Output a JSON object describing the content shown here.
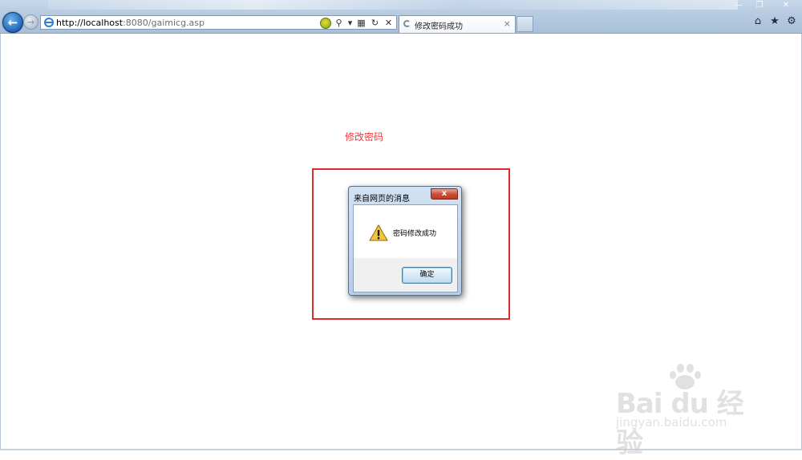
{
  "browser": {
    "address_url_host": "http://localhost",
    "address_url_rest": ":8080/gaimicg.asp",
    "tab_title": "修改密码成功",
    "tab_close": "×",
    "win_minimize": "—",
    "win_restore": "❐",
    "win_close": "✕",
    "icons": [
      "back-arrow-icon",
      "forward-arrow-icon",
      "ie-page-icon",
      "compatibility-icon",
      "search-icon",
      "dropdown-icon",
      "compat-view-icon",
      "refresh-icon",
      "stop-icon",
      "home-icon",
      "favorites-star-icon",
      "tools-gear-icon"
    ]
  },
  "page": {
    "heading": "修改密码"
  },
  "dialog": {
    "title": "来自网页的消息",
    "close_label": "x",
    "message": "密码修改成功",
    "ok_label": "确定",
    "icon": "warning-icon"
  },
  "watermark": {
    "brand": "Bai du 经验",
    "sub": "jingyan.baidu.com"
  },
  "colors": {
    "heading": "#ff3333",
    "highlight_border": "#e0292b"
  }
}
